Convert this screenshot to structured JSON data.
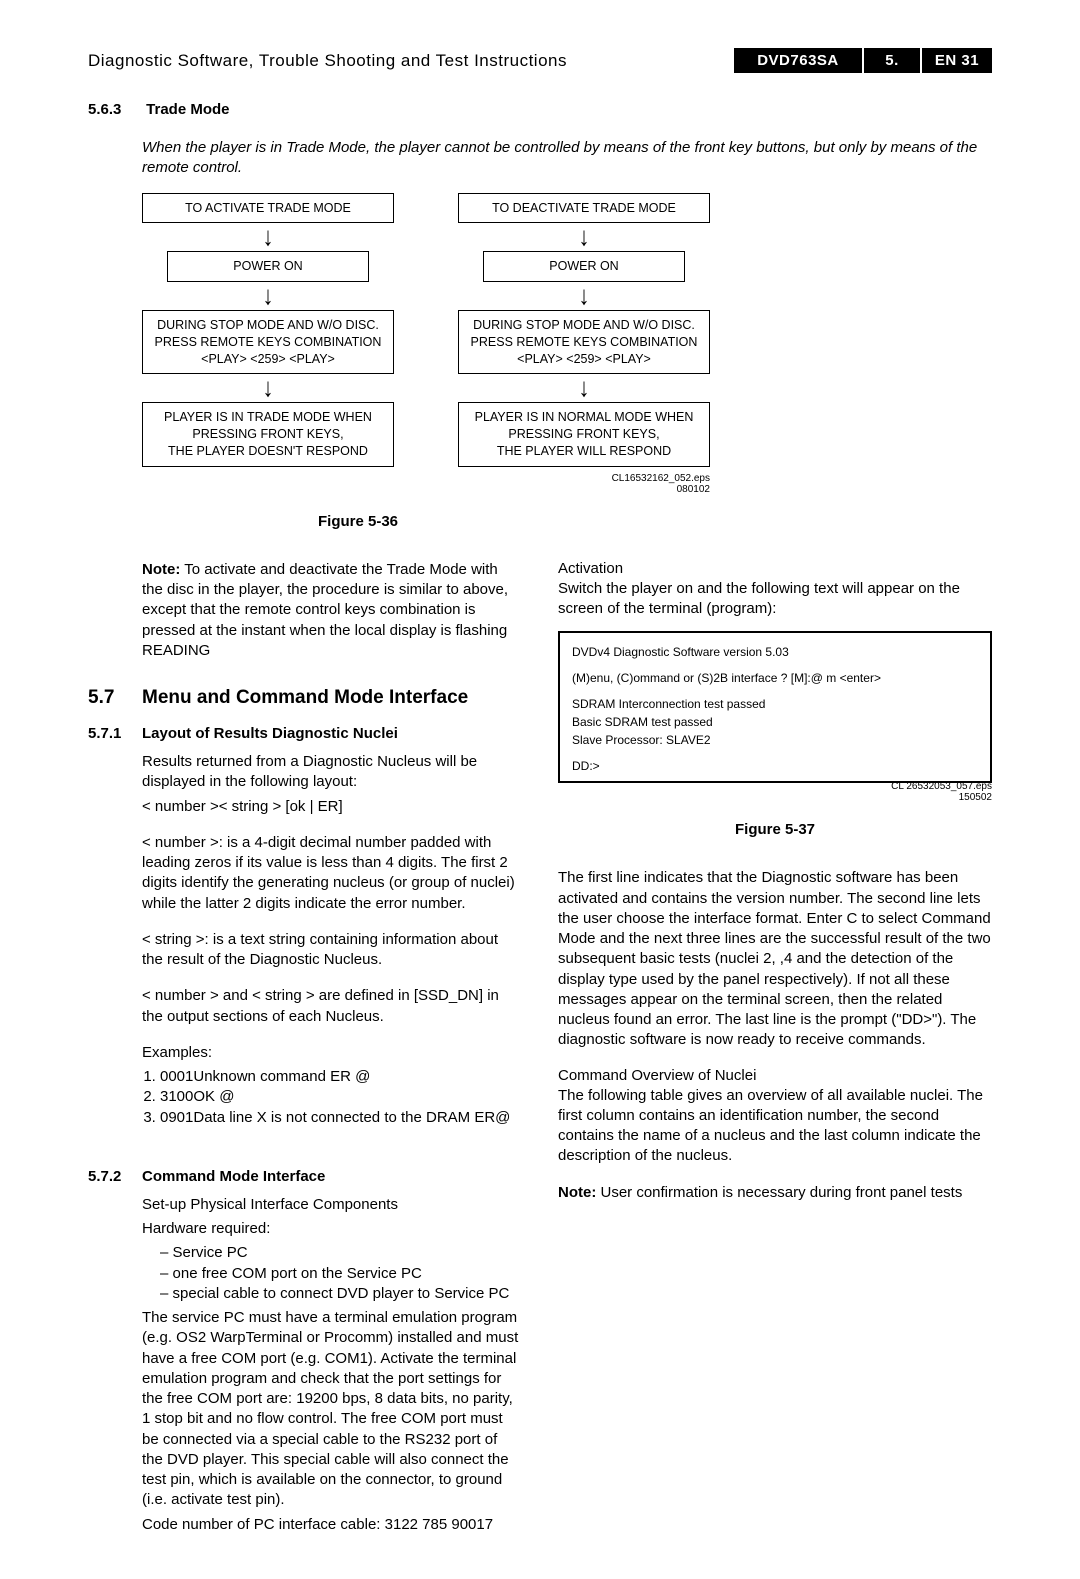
{
  "header": {
    "title": "Diagnostic Software, Trouble Shooting and Test Instructions",
    "model": "DVD763SA",
    "section": "5.",
    "page": "EN 31"
  },
  "s563": {
    "num": "5.6.3",
    "title": "Trade Mode",
    "intro": "When the player is in Trade Mode, the player cannot be controlled by means of the front key buttons, but only by means of the remote control.",
    "flow": {
      "left": {
        "b1": "TO ACTIVATE TRADE MODE",
        "b2": "POWER ON",
        "b3a": "DURING STOP MODE AND W/O DISC.",
        "b3b": "PRESS REMOTE KEYS COMBINATION",
        "b3c": "<PLAY> <259> <PLAY>",
        "b4a": "PLAYER IS IN TRADE MODE WHEN",
        "b4b": "PRESSING FRONT KEYS,",
        "b4c": "THE PLAYER DOESN'T RESPOND"
      },
      "right": {
        "b1": "TO DEACTIVATE TRADE MODE",
        "b2": "POWER ON",
        "b3a": "DURING STOP MODE AND W/O DISC.",
        "b3b": "PRESS REMOTE KEYS COMBINATION",
        "b3c": "<PLAY> <259> <PLAY>",
        "b4a": "PLAYER IS IN NORMAL MODE WHEN",
        "b4b": "PRESSING FRONT KEYS,",
        "b4c": "THE PLAYER WILL RESPOND"
      },
      "eps1": "CL16532162_052.eps",
      "eps2": "080102"
    },
    "fig": "Figure 5-36",
    "note_label": "Note:",
    "note": " To activate and deactivate the Trade Mode with the disc in the player, the procedure is similar to above, except that the remote control keys combination is pressed at the instant when the local display is flashing   READING"
  },
  "s57": {
    "num": "5.7",
    "title": "Menu and Command Mode Interface"
  },
  "s571": {
    "num": "5.7.1",
    "title": "Layout of Results Diagnostic Nuclei",
    "p1": "Results returned from a Diagnostic Nucleus will be displayed in the following layout:",
    "p2": "< number >< string > [ok | ER]",
    "p3": "< number >: is a 4-digit decimal number padded with leading zeros if its value is less than 4 digits. The first 2 digits identify the generating nucleus (or group of nuclei) while the latter 2 digits indicate the error number.",
    "p4": "< string >: is a text string containing information about the result of the Diagnostic Nucleus.",
    "p5": "< number > and < string > are defined in [SSD_DN] in the output sections of each Nucleus.",
    "ex_label": "Examples:",
    "ex1": "0001Unknown command ER @",
    "ex2": "3100OK @",
    "ex3": "0901Data line X is not connected to the DRAM ER@"
  },
  "s572": {
    "num": "5.7.2",
    "title": "Command Mode Interface",
    "p1": "Set-up Physical Interface Components",
    "p2": "Hardware required:",
    "d1": "Service PC",
    "d2": "one free COM port on the Service PC",
    "d3": "special cable to connect DVD player to Service PC",
    "p3": "The service PC must have a terminal emulation program (e.g. OS2 WarpTerminal or Procomm) installed and must have a free COM port (e.g. COM1). Activate the terminal emulation program and check that the port settings for the free COM port are: 19200 bps, 8 data bits, no parity, 1 stop bit and no flow control. The free COM port must be connected via a special cable to the RS232 port of the DVD player. This special cable will also connect the test pin, which is available on the connector, to ground (i.e. activate test pin).",
    "p4": "Code number of PC interface cable: 3122 785 90017"
  },
  "activation": {
    "title": "Activation",
    "p1": "Switch the player on and the following text will appear on the screen of the terminal (program):",
    "term": {
      "l1": "DVDv4  Diagnostic  Software  version  5.03",
      "l2": "(M)enu,  (C)ommand  or  (S)2B  interface  ?  [M]:@  m  <enter>",
      "l3": "SDRAM  Interconnection  test  passed",
      "l4": "Basic  SDRAM  test  passed",
      "l5": "Slave  Processor:  SLAVE2",
      "l6": "DD:>"
    },
    "eps1": "CL 26532053_057.eps",
    "eps2": "150502",
    "fig": "Figure 5-37",
    "p2": "The first line indicates that the Diagnostic software has been activated and contains the version number. The second line lets the user choose the interface format. Enter  C  to select Command Mode and the next three lines are the successful result of the two subsequent basic tests (nuclei 2, ,4 and the detection of the display type used by the panel respectively). If not all these messages appear on the terminal screen, then the related nucleus found an error. The last line is the prompt (\"DD>\"). The diagnostic software is now ready to receive commands.",
    "ov_title": "Command Overview of Nuclei",
    "p3": "The following table gives an overview of all available nuclei. The first column contains an identification number, the second contains the name of a nucleus and the last column indicate the description of the nucleus.",
    "note_label": "Note:",
    "note": " User confirmation is necessary during front panel tests"
  }
}
